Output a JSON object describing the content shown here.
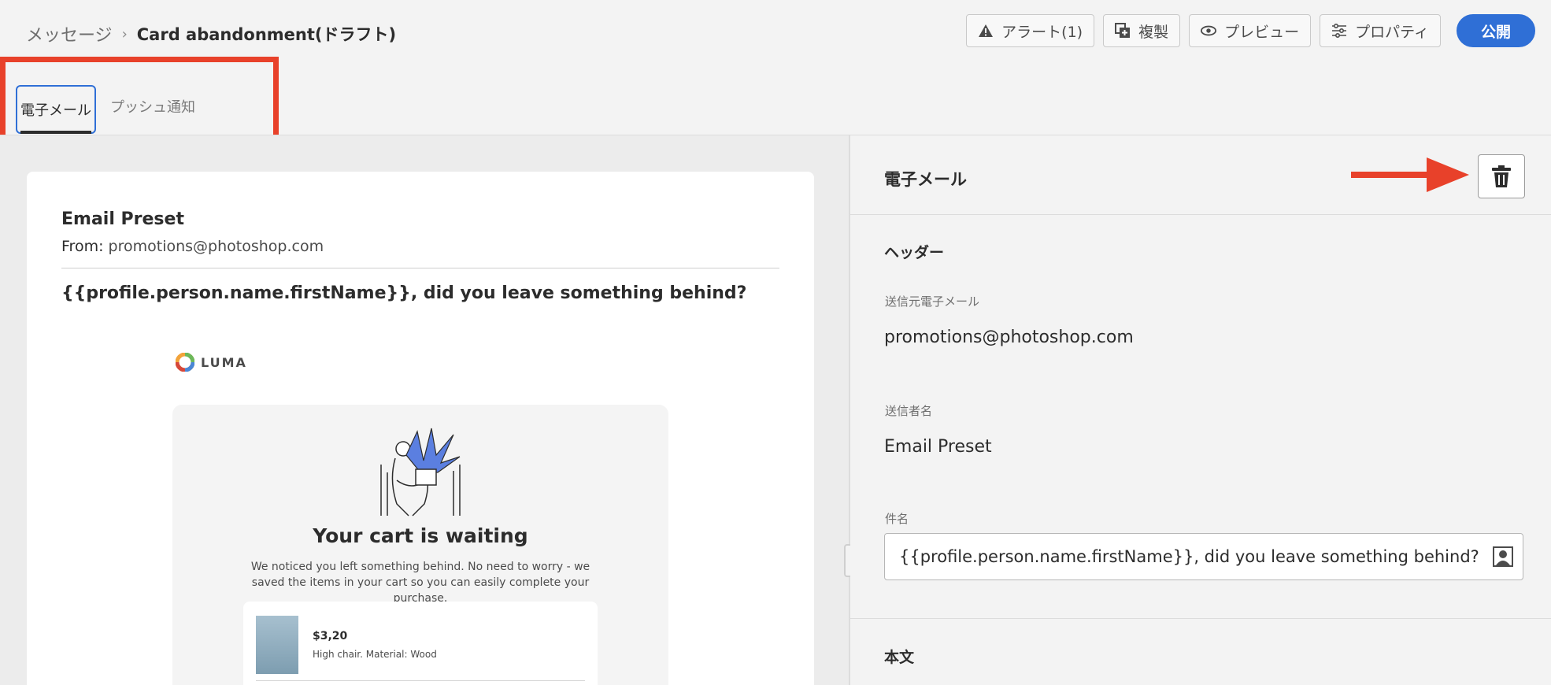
{
  "breadcrumb": {
    "parent": "メッセージ",
    "separator": "›",
    "current": "Card abandonment(ドラフト)"
  },
  "toolbar": {
    "alert_label": "アラート(1)",
    "duplicate_label": "複製",
    "preview_label": "プレビュー",
    "properties_label": "プロパティ",
    "publish_label": "公開"
  },
  "tabs": [
    {
      "label": "電子メール",
      "active": true
    },
    {
      "label": "プッシュ通知",
      "active": false
    }
  ],
  "preview": {
    "sender_name": "Email Preset",
    "from_label": "From:",
    "from_address": "promotions@photoshop.com",
    "subject": "{{profile.person.name.firstName}}, did you leave something behind?",
    "logo_text": "LUMA",
    "cart_title": "Your cart is waiting",
    "cart_desc": "We noticed you left something behind. No need to worry - we saved the items in your cart so you can easily complete your purchase.",
    "product_price": "$3,20",
    "product_desc": "High chair. Material: Wood"
  },
  "panel": {
    "title": "電子メール",
    "header_section": "ヘッダー",
    "from_email_label": "送信元電子メール",
    "from_email_value": "promotions@photoshop.com",
    "sender_name_label": "送信者名",
    "sender_name_value": "Email Preset",
    "subject_label": "件名",
    "subject_value": "{{profile.person.name.firstName}}, did you leave something behind?",
    "body_section": "本文"
  },
  "colors": {
    "accent": "#2f6fd6",
    "highlight": "#e8412a"
  },
  "icons": [
    "alert-icon",
    "duplicate-icon",
    "eye-icon",
    "properties-icon",
    "trash-icon",
    "personalization-icon"
  ]
}
